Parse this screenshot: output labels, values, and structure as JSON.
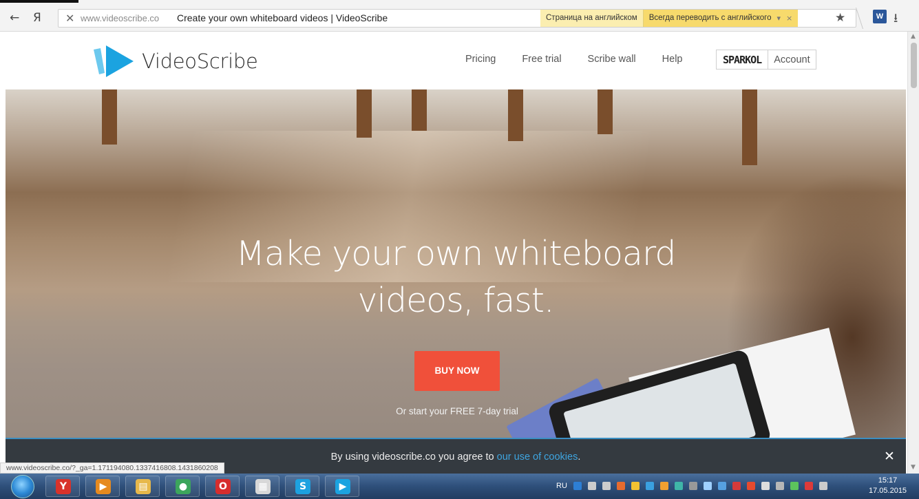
{
  "browser": {
    "back_glyph": "←",
    "yandex_glyph": "Я",
    "stop_glyph": "✕",
    "url_domain": "www.videoscribe.co",
    "page_title": "Create your own whiteboard videos | VideoScribe",
    "translate": {
      "page_language": "Страница на английском",
      "always_translate": "Всегда переводить с английского",
      "caret_glyph": "▾",
      "close_glyph": "×"
    },
    "star_glyph": "★",
    "word_glyph": "W",
    "download_glyph": "⭳"
  },
  "site": {
    "logo_text": "VideoScribe",
    "nav": [
      "Pricing",
      "Free trial",
      "Scribe wall",
      "Help"
    ],
    "sparkol_text": "SPARKOL",
    "account_label": "Account",
    "brand_colors": {
      "logo_blue": "#1ba3e0",
      "cta": "#f0503a"
    }
  },
  "hero": {
    "headline_line1": "Make your own whiteboard",
    "headline_line2": "videos, fast.",
    "cta_label": "BUY NOW",
    "trial_text": "Or start your FREE 7-day trial"
  },
  "cookie": {
    "prefix": "By using videoscribe.co you agree to ",
    "link": "our use of cookies",
    "suffix": ".",
    "close_glyph": "✕"
  },
  "status_url": "www.videoscribe.co/?_ga=1.171194080.1337416808.1431860208",
  "scrollbar": {
    "up_glyph": "▲",
    "down_glyph": "▼"
  },
  "taskbar": {
    "apps": [
      {
        "name": "yandex-browser",
        "glyph": "Y",
        "color": "#d8322b"
      },
      {
        "name": "media-player",
        "glyph": "▶",
        "color": "#e68a1f"
      },
      {
        "name": "file-explorer",
        "glyph": "▤",
        "color": "#e7b84b"
      },
      {
        "name": "chrome",
        "glyph": "●",
        "color": "#3ca55c"
      },
      {
        "name": "opera",
        "glyph": "O",
        "color": "#d62d2d"
      },
      {
        "name": "app-grid",
        "glyph": "▦",
        "color": "#d8d8d8"
      },
      {
        "name": "skype",
        "glyph": "S",
        "color": "#1da1e0"
      },
      {
        "name": "videoscribe",
        "glyph": "▶",
        "color": "#1ba3e0"
      }
    ],
    "tray_lang": "RU",
    "tray_icon_colors": [
      "#2d7fd5",
      "#cccccc",
      "#cccccc",
      "#e66b2e",
      "#f1c232",
      "#3aa0e0",
      "#f0a030",
      "#3fb6a8",
      "#999999",
      "#9fd0ff",
      "#56a0e0",
      "#d63a3a",
      "#e64a2e",
      "#dddddd",
      "#b7b7b7",
      "#5cc35c",
      "#dd3a3a",
      "#cccccc"
    ],
    "time": "15:17",
    "date": "17.05.2015"
  }
}
